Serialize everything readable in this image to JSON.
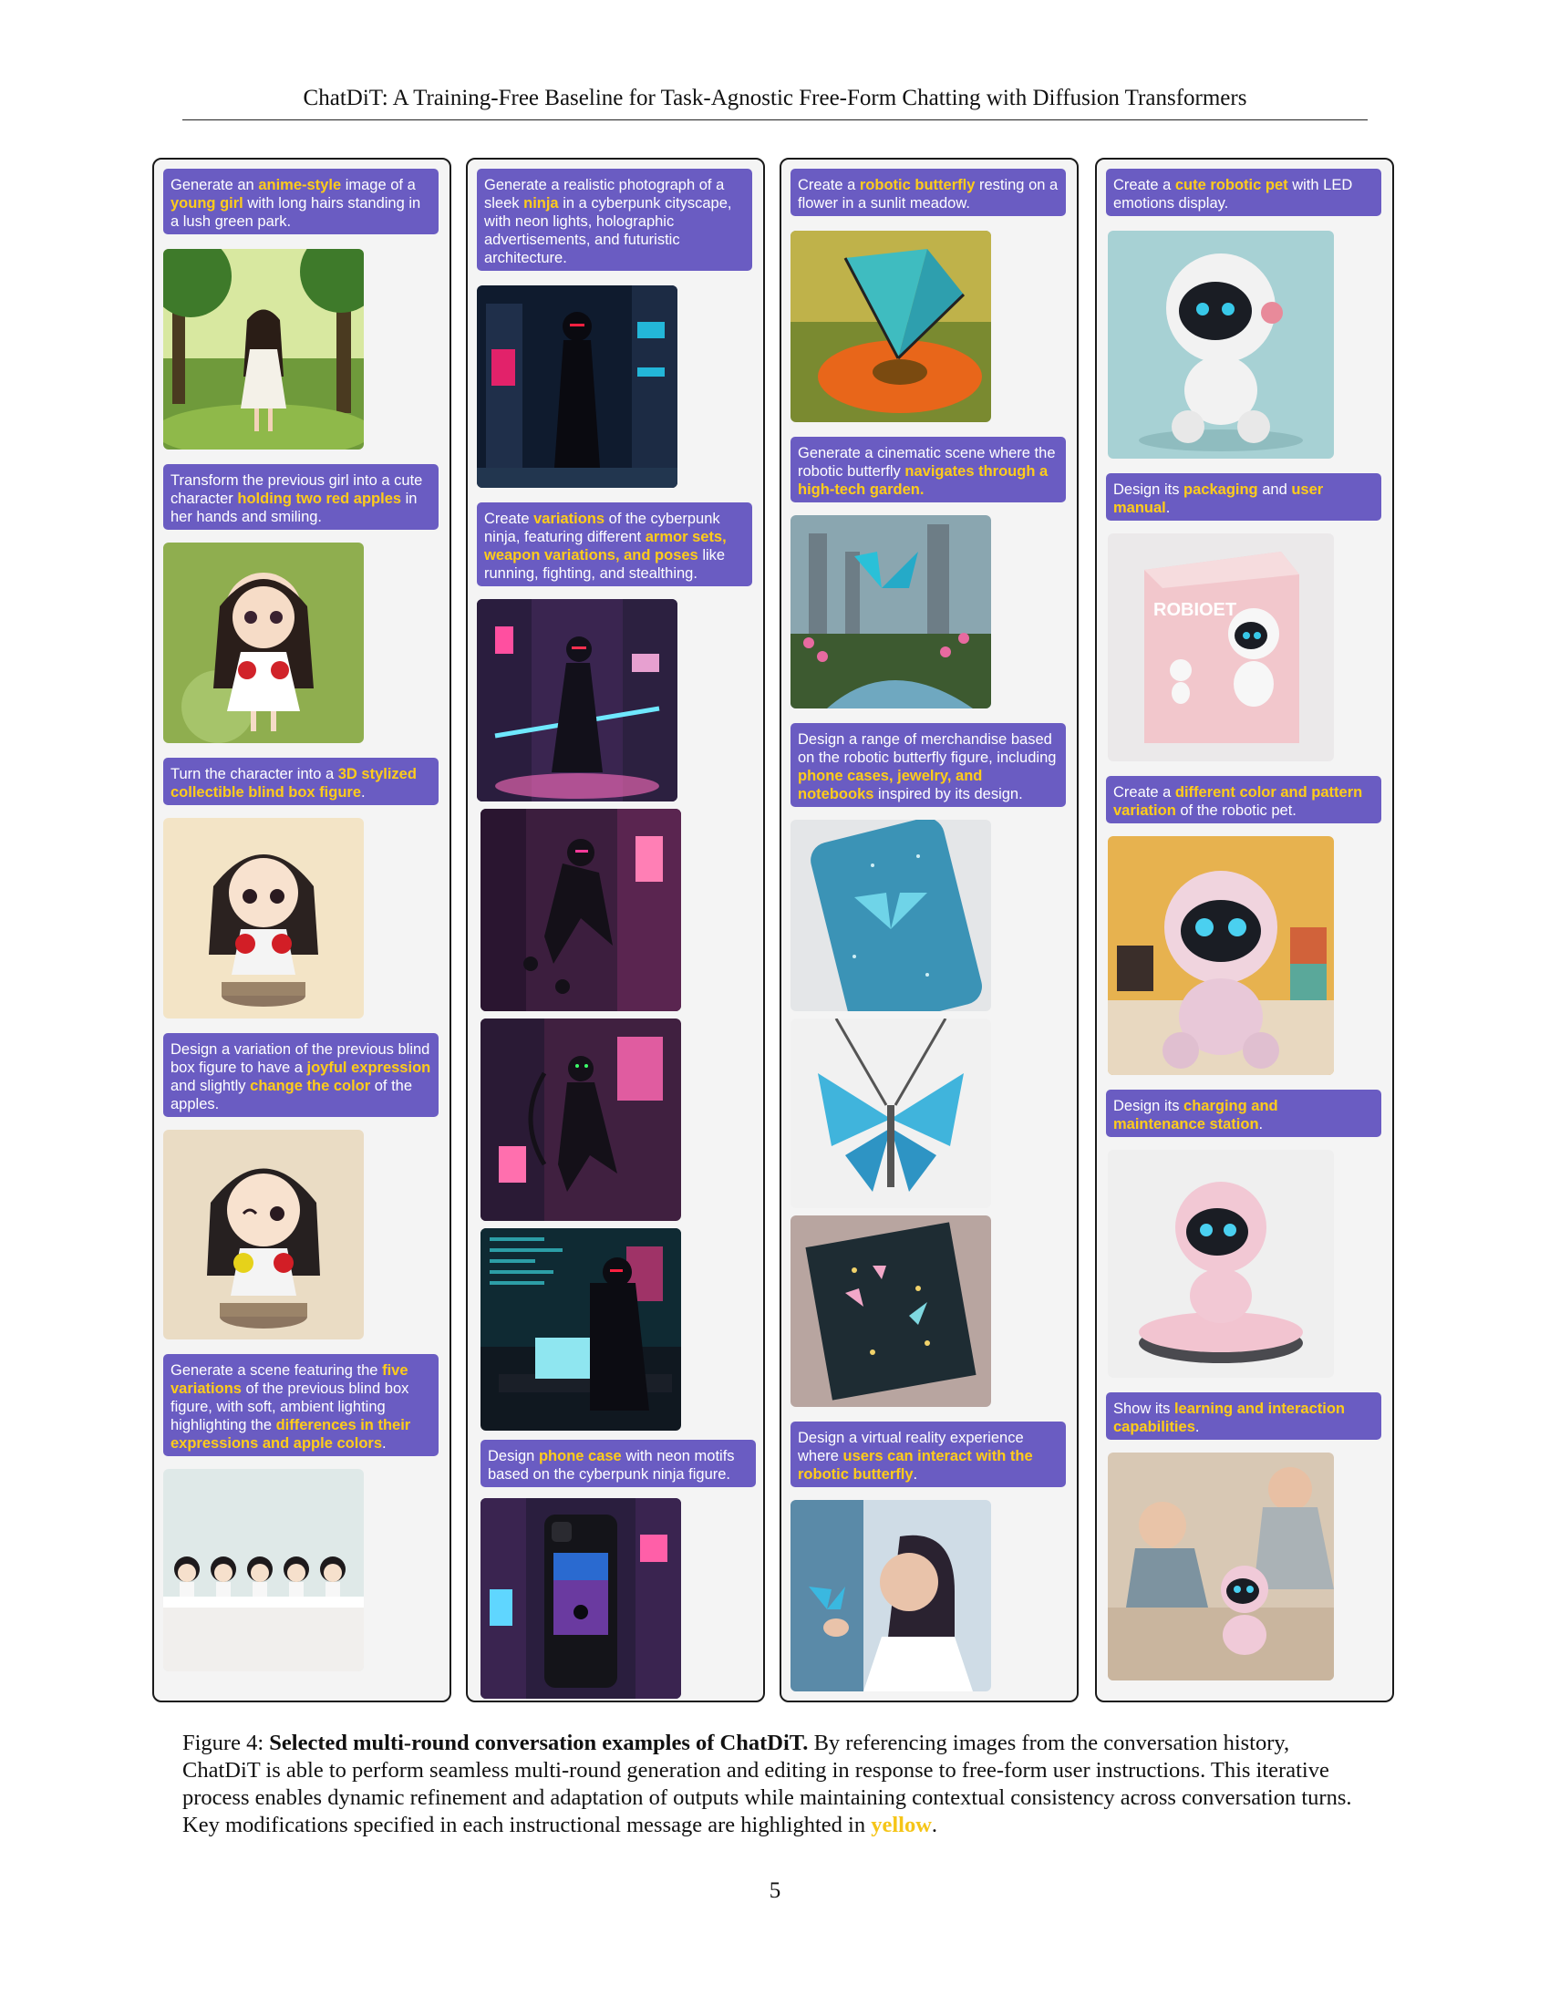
{
  "header": {
    "title": "ChatDiT: A Training-Free Baseline for Task-Agnostic Free-Form Chatting with Diffusion Transformers"
  },
  "columns": [
    {
      "prompts": [
        [
          [
            "Generate an ",
            false
          ],
          [
            "anime-style",
            true
          ],
          [
            " image of a ",
            false
          ],
          [
            "young girl",
            true
          ],
          [
            " with long hairs standing in a lush green park.",
            false
          ]
        ],
        [
          [
            "Transform the previous girl into a cute character ",
            false
          ],
          [
            "holding two red apples",
            true
          ],
          [
            " in her hands and smiling.",
            false
          ]
        ],
        [
          [
            "Turn the character into a ",
            false
          ],
          [
            "3D stylized collectible blind box figure",
            true
          ],
          [
            ".",
            false
          ]
        ],
        [
          [
            "Design a variation of the previous blind box figure to have a ",
            false
          ],
          [
            "joyful expression",
            true
          ],
          [
            " and slightly ",
            false
          ],
          [
            "change the color",
            true
          ],
          [
            " of the apples.",
            false
          ]
        ],
        [
          [
            "Generate a scene featuring the ",
            false
          ],
          [
            "five variations",
            true
          ],
          [
            " of the previous blind box figure, with soft, ambient lighting highlighting the ",
            false
          ],
          [
            "differences in their expressions and apple colors",
            true
          ],
          [
            ".",
            false
          ]
        ]
      ],
      "images": [
        "anime-girl-in-park-image",
        "chibi-girl-holding-apples-image",
        "blind-box-figure-image",
        "joyful-blind-box-figure-image",
        "five-figures-scene-image"
      ]
    },
    {
      "prompts": [
        [
          [
            "Generate a realistic photograph of a sleek ",
            false
          ],
          [
            "ninja",
            true
          ],
          [
            " in a cyberpunk cityscape, with neon lights, holographic advertisements, and futuristic architecture.",
            false
          ]
        ],
        [
          [
            "Create ",
            false
          ],
          [
            "variations",
            true
          ],
          [
            " of the cyberpunk ninja, featuring different ",
            false
          ],
          [
            "armor sets, weapon variations, and poses",
            true
          ],
          [
            " like running, fighting, and stealthing.",
            false
          ]
        ],
        [
          [
            "Design ",
            false
          ],
          [
            "phone case",
            true
          ],
          [
            " with neon motifs based on the cyberpunk ninja figure.",
            false
          ]
        ]
      ],
      "images": [
        "cyberpunk-ninja-image",
        "ninja-with-sword-image",
        "ninja-running-image",
        "ninja-with-bow-image",
        "ninja-at-laptop-image",
        "ninja-phone-case-image"
      ]
    },
    {
      "prompts": [
        [
          [
            "Create a ",
            false
          ],
          [
            "robotic butterfly",
            true
          ],
          [
            " resting on a flower in a sunlit meadow.",
            false
          ]
        ],
        [
          [
            "Generate a cinematic scene where the robotic butterfly ",
            false
          ],
          [
            "navigates through a high-tech garden.",
            true
          ]
        ],
        [
          [
            "Design a range of merchandise based on the robotic butterfly figure, including ",
            false
          ],
          [
            "phone cases, jewelry, and notebooks",
            true
          ],
          [
            "  inspired by its design.",
            false
          ]
        ],
        [
          [
            "Design a virtual reality experience where ",
            false
          ],
          [
            "users can interact with the robotic butterfly",
            true
          ],
          [
            ".",
            false
          ]
        ]
      ],
      "images": [
        "butterfly-on-flower-image",
        "butterfly-in-garden-image",
        "butterfly-phone-case-image",
        "butterfly-necklace-image",
        "butterfly-notebook-image",
        "vr-butterfly-woman-image"
      ]
    },
    {
      "prompts": [
        [
          [
            "Create a ",
            false
          ],
          [
            "cute robotic pet",
            true
          ],
          [
            " with LED emotions display.",
            false
          ]
        ],
        [
          [
            "Design its ",
            false
          ],
          [
            "packaging",
            true
          ],
          [
            " and ",
            false
          ],
          [
            "user manual",
            true
          ],
          [
            ".",
            false
          ]
        ],
        [
          [
            "Create a ",
            false
          ],
          [
            "different color and pattern variation",
            true
          ],
          [
            " of the robotic pet.",
            false
          ]
        ],
        [
          [
            "Design its ",
            false
          ],
          [
            "charging and maintenance station",
            true
          ],
          [
            ".",
            false
          ]
        ],
        [
          [
            "Show its ",
            false
          ],
          [
            "learning and interaction capabilities",
            true
          ],
          [
            ".",
            false
          ]
        ]
      ],
      "images": [
        "robot-pet-image",
        "robot-packaging-image",
        "pink-robot-variation-image",
        "robot-charging-station-image",
        "robot-with-child-image"
      ]
    }
  ],
  "packaging_text": "ROBIOET",
  "caption": {
    "label": "Figure 4: ",
    "lead": "Selected multi-round conversation examples of ChatDiT.",
    "body": " By referencing images from the conversation history, ChatDiT is able to perform seamless multi-round generation and editing in response to free-form user instructions. This iterative process enables dynamic refinement and adaptation of outputs while maintaining contextual consistency across conversation turns. Key modifications specified in each instructional message are highlighted in ",
    "highlight": "yellow",
    "end": "."
  },
  "page_number": "5",
  "colors": {
    "prompt_bg": "#6a5cc2",
    "highlight": "#ffcc1a"
  }
}
